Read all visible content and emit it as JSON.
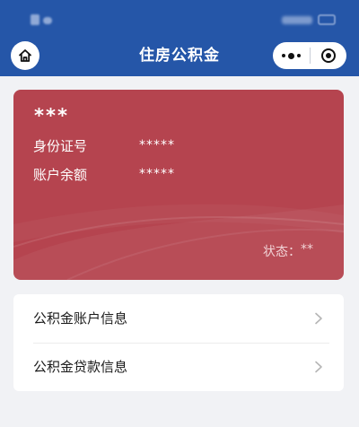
{
  "nav": {
    "title": "住房公积金",
    "home_icon": "home-icon",
    "more_icon": "more-dots-icon",
    "close_icon": "target-close-icon",
    "color": "#2556a8"
  },
  "card": {
    "name": "***",
    "id_label": "身份证号",
    "id_value": "*****",
    "balance_label": "账户余额",
    "balance_value": "*****",
    "status_label": "状态：",
    "status_value": "**",
    "color": "#b5444f"
  },
  "menu": {
    "items": [
      {
        "label": "公积金账户信息",
        "icon": "chevron-right-icon"
      },
      {
        "label": "公积金贷款信息",
        "icon": "chevron-right-icon"
      }
    ]
  }
}
